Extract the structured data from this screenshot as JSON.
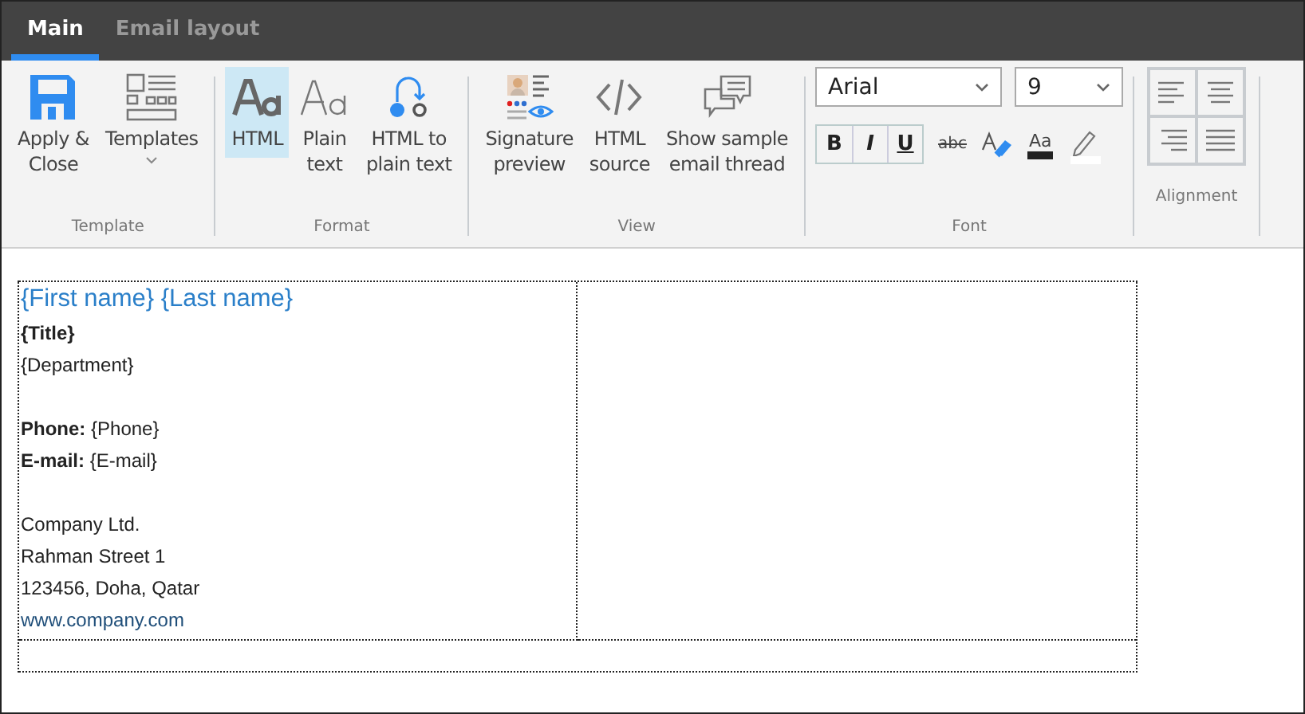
{
  "tabs": [
    {
      "label": "Main",
      "selected": true
    },
    {
      "label": "Email layout",
      "selected": false
    }
  ],
  "ribbon": {
    "groups": [
      {
        "label": "Template",
        "buttons": [
          {
            "kind": "save",
            "label": "Apply &\nClose",
            "selected": false,
            "dropdown": false
          },
          {
            "kind": "templates",
            "label": "Templates",
            "selected": false,
            "dropdown": true
          }
        ]
      },
      {
        "label": "Format",
        "buttons": [
          {
            "kind": "html",
            "label": "HTML",
            "selected": true,
            "dropdown": false
          },
          {
            "kind": "plain",
            "label": "Plain\ntext",
            "selected": false,
            "dropdown": false
          },
          {
            "kind": "convert",
            "label": "HTML to\nplain text",
            "selected": false,
            "dropdown": false
          }
        ]
      },
      {
        "label": "View",
        "buttons": [
          {
            "kind": "preview",
            "label": "Signature\npreview",
            "selected": false,
            "dropdown": false
          },
          {
            "kind": "source",
            "label": "HTML\nsource",
            "selected": false,
            "dropdown": false
          },
          {
            "kind": "thread",
            "label": "Show sample\nemail thread",
            "selected": false,
            "dropdown": false
          }
        ]
      }
    ],
    "font": {
      "label": "Font",
      "font_name": "Arial",
      "font_size": "9",
      "styles": [
        {
          "kind": "bold",
          "label": "B"
        },
        {
          "kind": "italic",
          "label": "I"
        },
        {
          "kind": "underline",
          "label": "U"
        }
      ],
      "strike_label": "abc",
      "color_label": "Aa"
    },
    "alignment": {
      "label": "Alignment",
      "buttons": [
        {
          "kind": "left"
        },
        {
          "kind": "center"
        },
        {
          "kind": "right"
        },
        {
          "kind": "justify"
        }
      ]
    }
  },
  "signature": [
    {
      "kind": "name",
      "text": "{First name} {Last name}"
    },
    {
      "kind": "title",
      "text": "{Title}"
    },
    {
      "kind": "text",
      "text": "{Department}"
    },
    {
      "kind": "blank"
    },
    {
      "kind": "field",
      "label": "Phone:",
      "text": "{Phone}"
    },
    {
      "kind": "field",
      "label": "E-mail:",
      "text": "{E-mail}"
    },
    {
      "kind": "blank"
    },
    {
      "kind": "text",
      "text": "Company Ltd."
    },
    {
      "kind": "text",
      "text": "Rahman Street 1"
    },
    {
      "kind": "text",
      "text": "123456, Doha, Qatar"
    },
    {
      "kind": "link",
      "text": "www.company.com"
    }
  ]
}
